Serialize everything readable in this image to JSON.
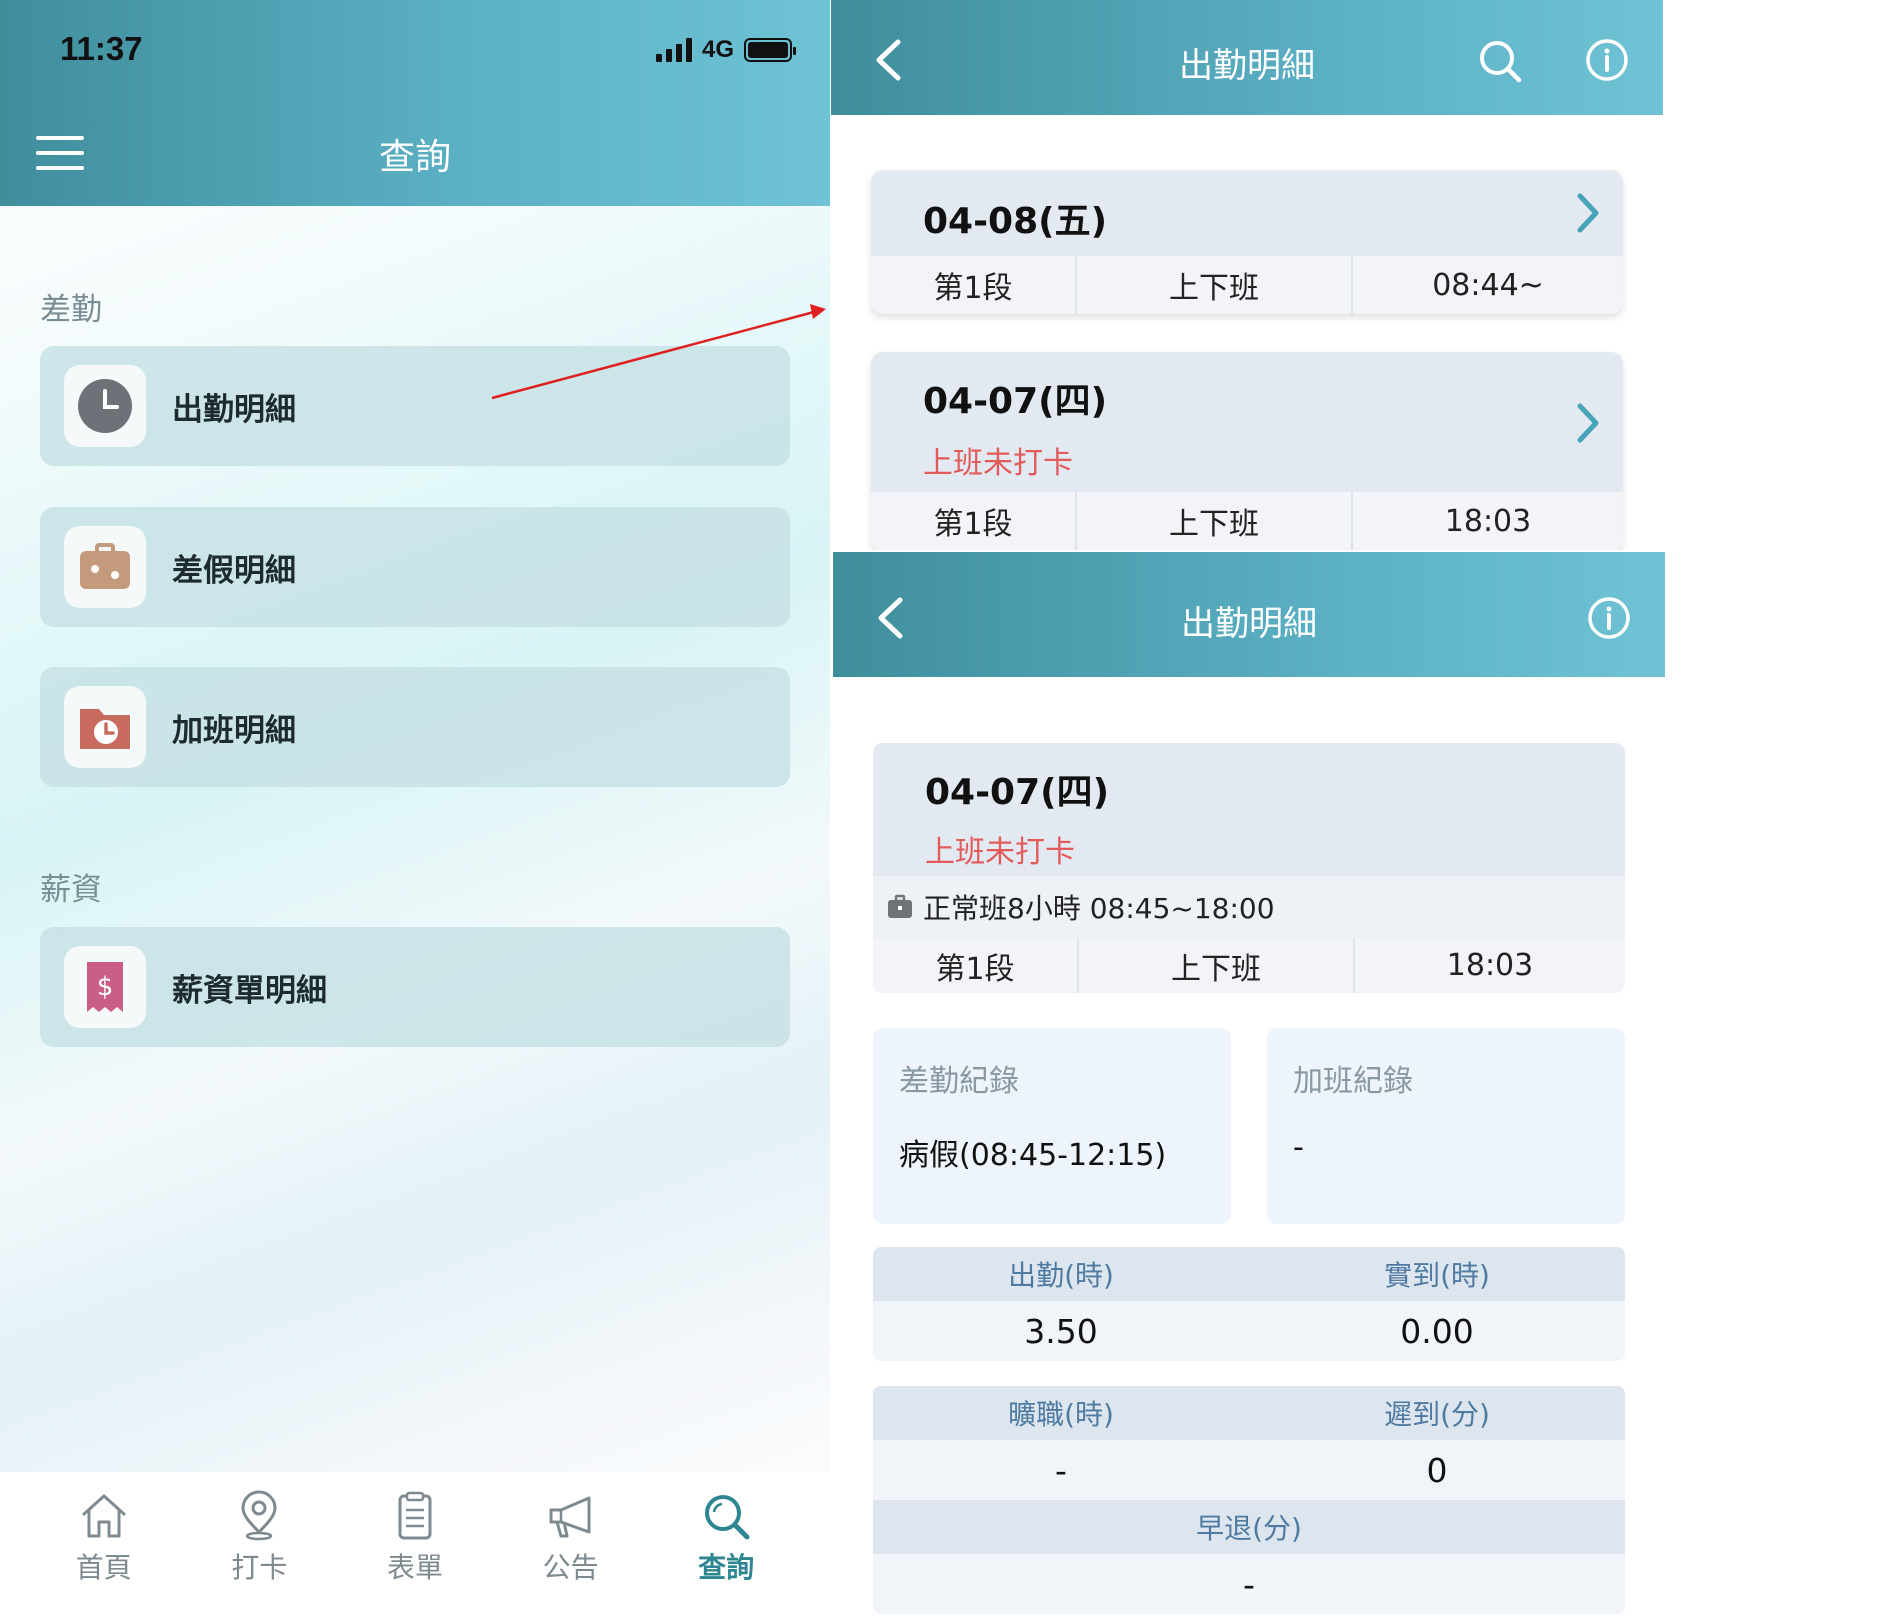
{
  "colors": {
    "header_start": "#3f8e9c",
    "header_end": "#6fc3d5",
    "warning_red": "#e15b5b",
    "active_tab": "#2f8693",
    "stat_label": "#4f7ba2",
    "annotation_arrow": "#e02020"
  },
  "left_screen": {
    "status_bar": {
      "time": "11:37",
      "network": "4G"
    },
    "header": {
      "title": "查詢",
      "menu_icon": "hamburger-menu-icon"
    },
    "sections": [
      {
        "label": "差勤",
        "items": [
          {
            "label": "出勤明細",
            "icon": "clock-icon"
          },
          {
            "label": "差假明細",
            "icon": "suitcase-icon"
          },
          {
            "label": "加班明細",
            "icon": "folder-clock-icon"
          }
        ]
      },
      {
        "label": "薪資",
        "items": [
          {
            "label": "薪資單明細",
            "icon": "receipt-dollar-icon"
          }
        ]
      }
    ],
    "bottom_nav": [
      {
        "label": "首頁",
        "icon": "home-icon",
        "active": false
      },
      {
        "label": "打卡",
        "icon": "location-pin-icon",
        "active": false
      },
      {
        "label": "表單",
        "icon": "clipboard-icon",
        "active": false
      },
      {
        "label": "公告",
        "icon": "megaphone-icon",
        "active": false
      },
      {
        "label": "查詢",
        "icon": "search-icon",
        "active": true
      }
    ]
  },
  "list_screen": {
    "header": {
      "title": "出勤明細"
    },
    "days": [
      {
        "date": "04-08(五)",
        "status": "",
        "segment": {
          "name": "第1段",
          "type": "上下班",
          "time": "08:44~"
        }
      },
      {
        "date": "04-07(四)",
        "status": "上班未打卡",
        "segment": {
          "name": "第1段",
          "type": "上下班",
          "time": "18:03"
        }
      }
    ]
  },
  "detail_screen": {
    "header": {
      "title": "出勤明細"
    },
    "date": "04-07(四)",
    "status": "上班未打卡",
    "shift": "正常班8小時 08:45~18:00",
    "segment": {
      "name": "第1段",
      "type": "上下班",
      "time": "18:03"
    },
    "leave_record": {
      "title": "差勤紀錄",
      "value": "病假(08:45-12:15)"
    },
    "overtime_record": {
      "title": "加班紀錄",
      "value": "-"
    },
    "stats": {
      "attendance_label": "出勤(時)",
      "attendance_value": "3.50",
      "actual_label": "實到(時)",
      "actual_value": "0.00",
      "absent_label": "曠職(時)",
      "absent_value": "-",
      "late_label": "遲到(分)",
      "late_value": "0",
      "early_label": "早退(分)",
      "early_value": "-"
    }
  }
}
